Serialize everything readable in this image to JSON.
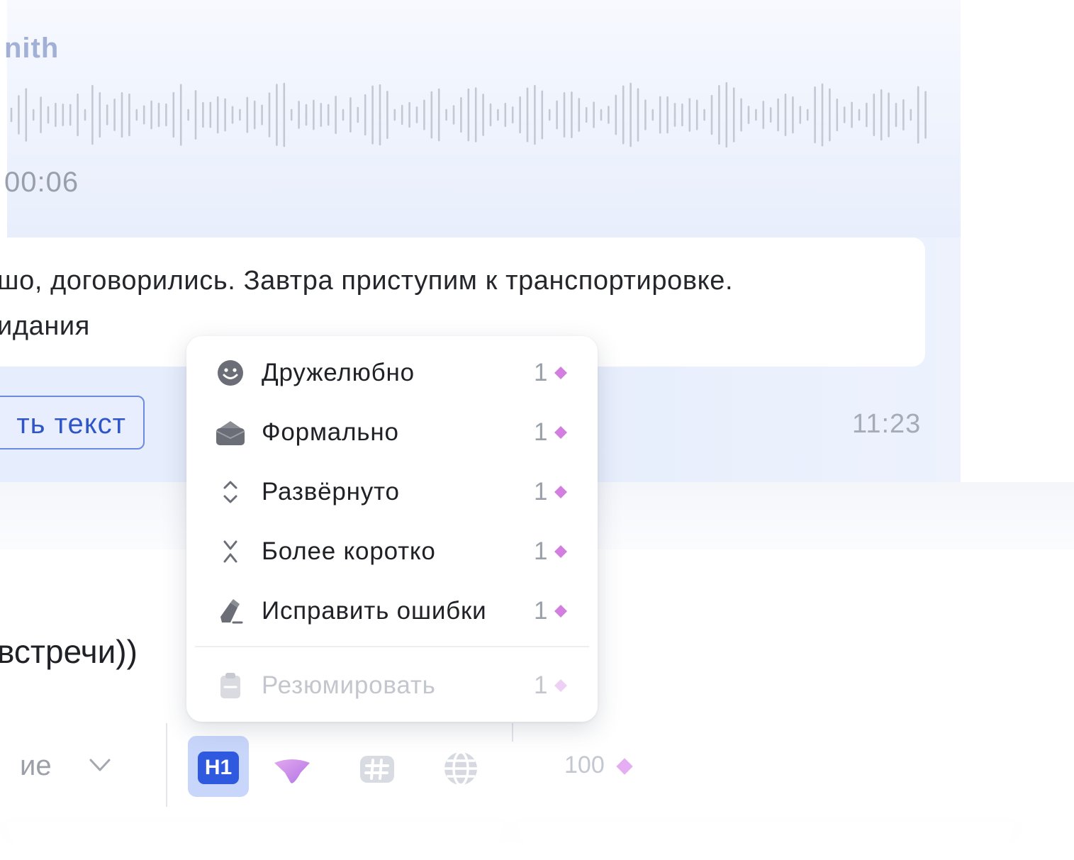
{
  "voice_message": {
    "sender": "nith",
    "duration": "00:06"
  },
  "message": {
    "line1": "шо, договорились. Завтра приступим к транспортировке.",
    "line2": "идания",
    "text_button_label": "ть текст",
    "time": "11:23"
  },
  "composer": {
    "input_text": "встречи))",
    "style_hint": "ие",
    "h1_label": "H1",
    "counter": "100"
  },
  "rewrite_menu": {
    "items": [
      {
        "label": "Дружелюбно",
        "cost": "1",
        "icon": "smile-icon"
      },
      {
        "label": "Формально",
        "cost": "1",
        "icon": "briefcase-icon"
      },
      {
        "label": "Развёрнуто",
        "cost": "1",
        "icon": "expand-icon"
      },
      {
        "label": "Более коротко",
        "cost": "1",
        "icon": "shorten-icon"
      },
      {
        "label": "Исправить ошибки",
        "cost": "1",
        "icon": "pencil-eraser-icon"
      }
    ],
    "summary_item": {
      "label": "Резюмировать",
      "cost": "1",
      "icon": "clipboard-icon"
    }
  },
  "colors": {
    "accent": "#2f5ae0",
    "diamond": "#d27fe0",
    "icon_gray": "#6b6e76"
  }
}
